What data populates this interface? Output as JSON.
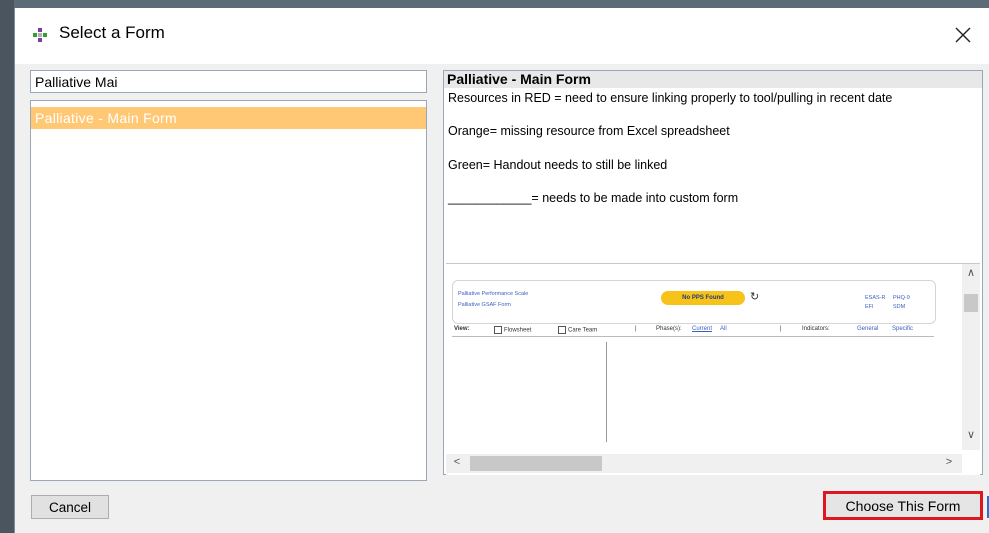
{
  "dialog": {
    "title": "Select a Form",
    "icon": "app-dots-icon",
    "close_icon": "close-icon"
  },
  "search": {
    "value": "Palliative Mai"
  },
  "form_list": {
    "items": [
      {
        "label": "Palliative - Main Form",
        "selected": true
      }
    ]
  },
  "preview": {
    "title": "Palliative - Main Form",
    "lines": [
      "Resources in RED = need to ensure linking properly to tool/pulling in recent date",
      "Orange= missing resource from Excel spreadsheet",
      "Green= Handout needs to still be linked",
      "____________= needs to be made into custom form"
    ],
    "thumbnail": {
      "link1": "Palliative Performance Scale",
      "link2": "Palliative GSAF Form",
      "badge": "No PPS Found",
      "refresh_icon": "refresh-icon",
      "link3": "ESAS-R",
      "link4": "PHQ-9",
      "link5": "EFI",
      "link6": "SDM",
      "view_label": "View:",
      "flowsheet": "Flowsheet",
      "care_team": "Care Team",
      "phases_label": "Phase(s):",
      "current": "Current",
      "all": "All",
      "indicators_label": "Indicators:",
      "general": "General",
      "specific": "Specific"
    }
  },
  "buttons": {
    "cancel": "Cancel",
    "choose": "Choose This Form"
  },
  "colors": {
    "selection": "#ffc875",
    "highlight_border": "#e0161f",
    "badge": "#f7c21a"
  }
}
